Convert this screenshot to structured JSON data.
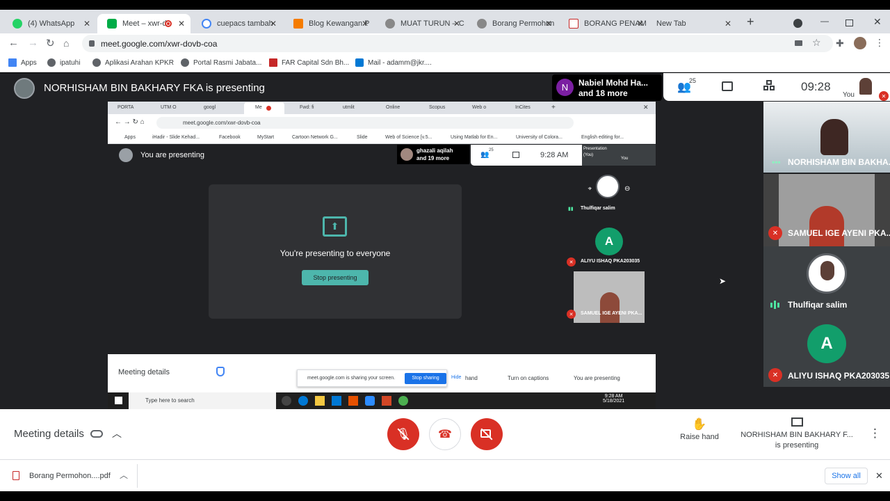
{
  "browser": {
    "tabs": [
      {
        "title": "(4) WhatsApp",
        "color": "#25d366"
      },
      {
        "title": "Meet – xwr-d",
        "color": "#00ac47",
        "recording": true
      },
      {
        "title": "cuepacs tambah",
        "color": "#4285f4"
      },
      {
        "title": "Blog Kewangan P",
        "color": "#f57c00"
      },
      {
        "title": "MUAT TURUN – C",
        "color": "#777"
      },
      {
        "title": "Borang Permohon",
        "color": "#777"
      },
      {
        "title": "BORANG PENAM",
        "color": "#c62828"
      },
      {
        "title": "New Tab",
        "color": null
      }
    ],
    "new_tab_symbol": "+",
    "url": "meet.google.com/xwr-dovb-coa",
    "bookmarks": [
      {
        "label": "Apps",
        "color": "#4285f4"
      },
      {
        "label": "ipatuhi",
        "color": "#5f6368"
      },
      {
        "label": "Aplikasi Arahan KPKR",
        "color": "#5f6368"
      },
      {
        "label": "Portal Rasmi Jabata...",
        "color": "#5f6368"
      },
      {
        "label": "FAR Capital Sdn Bh...",
        "color": "#c62828"
      },
      {
        "label": "Mail - adamm@jkr....",
        "color": "#0078d4"
      }
    ]
  },
  "meet": {
    "presenter_banner": "NORHISHAM BIN BAKHARY FKA is presenting",
    "active_speaker": {
      "initial": "N",
      "name": "Nabiel Mohd Ha...",
      "more": "and 18 more"
    },
    "participants_count": "25",
    "time": "09:28",
    "self_label": "You",
    "tiles": [
      {
        "name": "NORHISHAM BIN BAKHA...",
        "muted": false,
        "speaking": true
      },
      {
        "name": "SAMUEL IGE AYENI PKA...",
        "muted": true
      },
      {
        "name": "Thulfiqar salim",
        "muted": false,
        "speaking": true
      },
      {
        "name": "ALIYU ISHAQ PKA203035",
        "muted": true,
        "initial": "A"
      }
    ],
    "bottom": {
      "meeting_details": "Meeting details",
      "raise_hand": "Raise hand",
      "presenting_line1": "NORHISHAM BIN BAKHARY F...",
      "presenting_line2": "is presenting"
    }
  },
  "shared_screen": {
    "tabs": [
      "PORTA",
      "UTM O",
      "googl",
      "Me",
      "Fwd: fi",
      "utmlit",
      "Online",
      "Scopus",
      "Web o",
      "InCites"
    ],
    "url": "meet.google.com/xwr-dovb-coa",
    "bookmarks": [
      "Apps",
      "iHadir - Slide Kehad...",
      "Facebook",
      "MyStart",
      "Cartoon Network G...",
      "Slide",
      "Web of Science [v.5...",
      "Using Matlab for En...",
      "University of Colora...",
      "English editing for..."
    ],
    "you_are_presenting": "You are presenting",
    "speaker": {
      "name": "ghazali aqilah",
      "more": "and 19 more"
    },
    "participants_count": "25",
    "time": "9:28 AM",
    "presentation_label": "Presentation (You)",
    "you_label": "You",
    "presenting_to_everyone": "You're presenting to everyone",
    "stop_presenting": "Stop presenting",
    "side_tiles": [
      {
        "name": "Thulfiqar salim"
      },
      {
        "name": "ALIYU ISHAQ PKA203035",
        "initial": "A"
      },
      {
        "name": "SAMUEL IGE AYENI PKA..."
      }
    ],
    "meeting_details": "Meeting details",
    "sharing_notice": "meet.google.com is sharing your screen.",
    "stop_sharing": "Stop sharing",
    "hide": "Hide",
    "hand_label": "hand",
    "turn_on_captions": "Turn on captions",
    "you_are_presenting_btn": "You are presenting",
    "taskbar_search": "Type here to search",
    "taskbar_time": "9:28 AM",
    "taskbar_date": "5/18/2021"
  },
  "download": {
    "filename": "Borang Permohon....pdf",
    "show_all": "Show all"
  }
}
